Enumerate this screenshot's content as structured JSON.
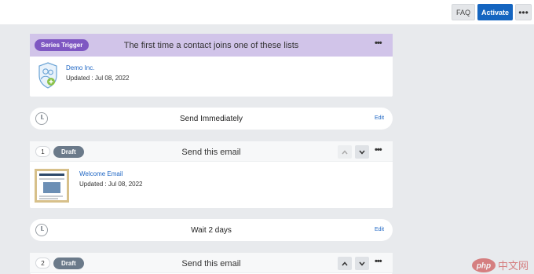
{
  "header": {
    "faq_label": "FAQ",
    "activate_label": "Activate",
    "more_label": "•••"
  },
  "trigger": {
    "badge": "Series Trigger",
    "title": "The first time a contact joins one of these lists",
    "more_label": "•••",
    "list_name": "Demo Inc.",
    "updated": "Updated : Jul 08, 2022"
  },
  "steps": [
    {
      "type": "wait",
      "label": "Send Immediately",
      "edit_label": "Edit"
    },
    {
      "type": "email",
      "number": "1",
      "status": "Draft",
      "title": "Send this email",
      "more_label": "•••",
      "email_name": "Welcome Email",
      "updated": "Updated : Jul 08, 2022"
    },
    {
      "type": "wait",
      "label": "Wait 2 days",
      "edit_label": "Edit"
    },
    {
      "type": "email",
      "number": "2",
      "status": "Draft",
      "title": "Send this email",
      "more_label": "•••"
    }
  ],
  "icons": {
    "contacts": "contacts-icon",
    "clock": "clock-icon",
    "up": "chevron-up-icon",
    "down": "chevron-down-icon"
  },
  "colors": {
    "accent": "#1565c0",
    "trigger_header": "#d1c4e9",
    "trigger_badge": "#7e57c2",
    "draft_badge": "#6b7a8a",
    "canvas": "#e8eaed"
  },
  "watermark": "php中文网"
}
